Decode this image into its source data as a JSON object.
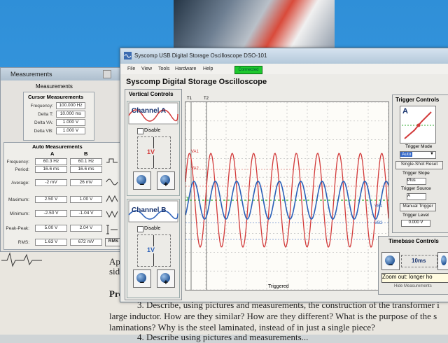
{
  "colors": {
    "channel_a": "#d23a3a",
    "channel_b": "#2a5fb8",
    "trigger": "#2fae2f",
    "connected": "#1ec82e"
  },
  "paper": {
    "lines": [
      "App",
      "side",
      "Pro",
      "3. Describe, using pictures and measurements, the construction of the transformer i",
      "large inductor. How are they similar? How are they different? What is the purpose of the s",
      "laminations? Why is the steel laminated, instead of in just a single piece?",
      "4. Describe using pictures and measurements..."
    ]
  },
  "measurements_window": {
    "title": "Measurements",
    "heading": "Measurements",
    "cursor": {
      "heading": "Cursor Measurements",
      "rows": [
        {
          "label": "Frequency:",
          "value": "100.000 Hz"
        },
        {
          "label": "Delta T:",
          "value": "10.000 ms"
        },
        {
          "label": "Delta VA:",
          "value": "1.000 V"
        },
        {
          "label": "Delta VB:",
          "value": "1.000 V"
        }
      ]
    },
    "auto": {
      "heading": "Auto Measurements",
      "col_a": "A",
      "col_b": "B",
      "rows": [
        {
          "label": "Frequency:",
          "a": "60.3 Hz",
          "b": "60.1 Hz"
        },
        {
          "label": "Period:",
          "a": "16.6 ms",
          "b": "16.6 ms"
        },
        {
          "label": "Average:",
          "a": "-2 mV",
          "b": "26 mV"
        },
        {
          "label": "Maximum:",
          "a": "2.50 V",
          "b": "1.00 V"
        },
        {
          "label": "Minimum:",
          "a": "-2.50 V",
          "b": "-1.04 V"
        },
        {
          "label": "Peak-Peak:",
          "a": "5.00 V",
          "b": "2.04 V"
        },
        {
          "label": "RMS:",
          "a": "1.63 V",
          "b": "672 mV"
        }
      ],
      "rms_button": "RMS"
    }
  },
  "scope": {
    "window_title": "Syscomp USB Digital Storage Oscilloscope DSO-101",
    "menu": [
      "File",
      "View",
      "Tools",
      "Hardware",
      "Help"
    ],
    "status": "Connected",
    "app_title": "Syscomp Digital Storage Oscilloscope",
    "vertical": {
      "heading": "Vertical Controls",
      "channel_a": {
        "name": "Channel A",
        "disable": "Disable",
        "scale": "1V"
      },
      "channel_b": {
        "name": "Channel B",
        "disable": "Disable",
        "scale": "1V"
      }
    },
    "display": {
      "cursor_t1": "T1",
      "cursor_t2": "T2",
      "va1": "VA1",
      "va2": "VA2",
      "vb1": "VB1",
      "vb2": "VB2",
      "trigger_marker": "T",
      "status": "Triggered"
    },
    "trigger": {
      "heading": "Trigger Controls",
      "channel_label": "A",
      "mode_label": "Trigger Mode",
      "mode_value": "Auto",
      "single_shot": "Single-Shot Reset",
      "slope_label": "Trigger Slope",
      "slope_value": "Plus",
      "source_label": "Trigger Source",
      "source_value": "A",
      "manual": "Manual Trigger",
      "level_label": "Trigger Level",
      "level_value": "0.000 V"
    },
    "timebase": {
      "heading": "Timebase Controls",
      "value": "10ms",
      "tooltip": "Zoom out: longer ho",
      "hide": "Hide Measurements"
    }
  }
}
